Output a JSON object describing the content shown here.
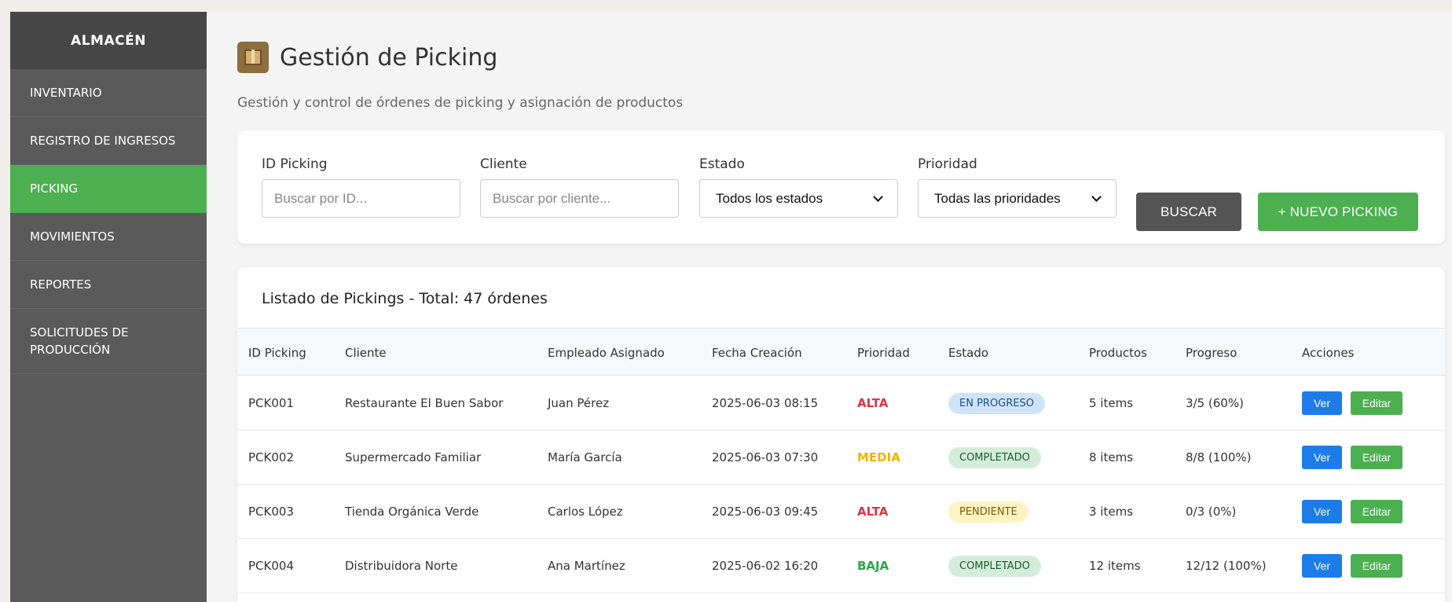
{
  "sidebar": {
    "brand": "ALMACÉN",
    "items": [
      {
        "label": "INVENTARIO"
      },
      {
        "label": "REGISTRO DE INGRESOS"
      },
      {
        "label": "PICKING"
      },
      {
        "label": "MOVIMIENTOS"
      },
      {
        "label": "REPORTES"
      },
      {
        "label": "SOLICITUDES DE PRODUCCIÓN"
      }
    ],
    "active_item": "PICKING"
  },
  "header": {
    "icon": "package-icon",
    "title": "Gestión de Picking",
    "subtitle": "Gestión y control de órdenes de picking y asignación de productos"
  },
  "filters": {
    "id_label": "ID Picking",
    "id_placeholder": "Buscar por ID...",
    "client_label": "Cliente",
    "client_placeholder": "Buscar por cliente...",
    "status_label": "Estado",
    "status_selected": "Todos los estados",
    "priority_label": "Prioridad",
    "priority_selected": "Todas las prioridades",
    "search_button": "BUSCAR",
    "new_button": "+ NUEVO PICKING"
  },
  "table": {
    "title": "Listado de Pickings - Total: 47 órdenes",
    "headers": [
      "ID Picking",
      "Cliente",
      "Empleado Asignado",
      "Fecha Creación",
      "Prioridad",
      "Estado",
      "Productos",
      "Progreso",
      "Acciones"
    ],
    "view_label": "Ver",
    "edit_label": "Editar",
    "rows": [
      {
        "id": "PCK001",
        "client": "Restaurante El Buen Sabor",
        "employee": "Juan Pérez",
        "date": "2025-06-03 08:15",
        "priority": "ALTA",
        "status": "EN PROGRESO",
        "products": "5 items",
        "progress": "3/5 (60%)"
      },
      {
        "id": "PCK002",
        "client": "Supermercado Familiar",
        "employee": "María García",
        "date": "2025-06-03 07:30",
        "priority": "MEDIA",
        "status": "COMPLETADO",
        "products": "8 items",
        "progress": "8/8 (100%)"
      },
      {
        "id": "PCK003",
        "client": "Tienda Orgánica Verde",
        "employee": "Carlos López",
        "date": "2025-06-03 09:45",
        "priority": "ALTA",
        "status": "PENDIENTE",
        "products": "3 items",
        "progress": "0/3 (0%)"
      },
      {
        "id": "PCK004",
        "client": "Distribuidora Norte",
        "employee": "Ana Martínez",
        "date": "2025-06-02 16:20",
        "priority": "BAJA",
        "status": "COMPLETADO",
        "products": "12 items",
        "progress": "12/12 (100%)"
      }
    ]
  },
  "colors": {
    "priority": {
      "ALTA": "#dc3545",
      "MEDIA": "#f0b400",
      "BAJA": "#28a745"
    },
    "status_bg": {
      "EN PROGRESO": "#cfe4fb",
      "COMPLETADO": "#d4edda",
      "PENDIENTE": "#fff3c4"
    },
    "status_fg": {
      "EN PROGRESO": "#1d4f86",
      "COMPLETADO": "#1f5b2c",
      "PENDIENTE": "#7a5a00"
    },
    "accent": "#4caf50",
    "sidebar": "#5a5a5a"
  }
}
